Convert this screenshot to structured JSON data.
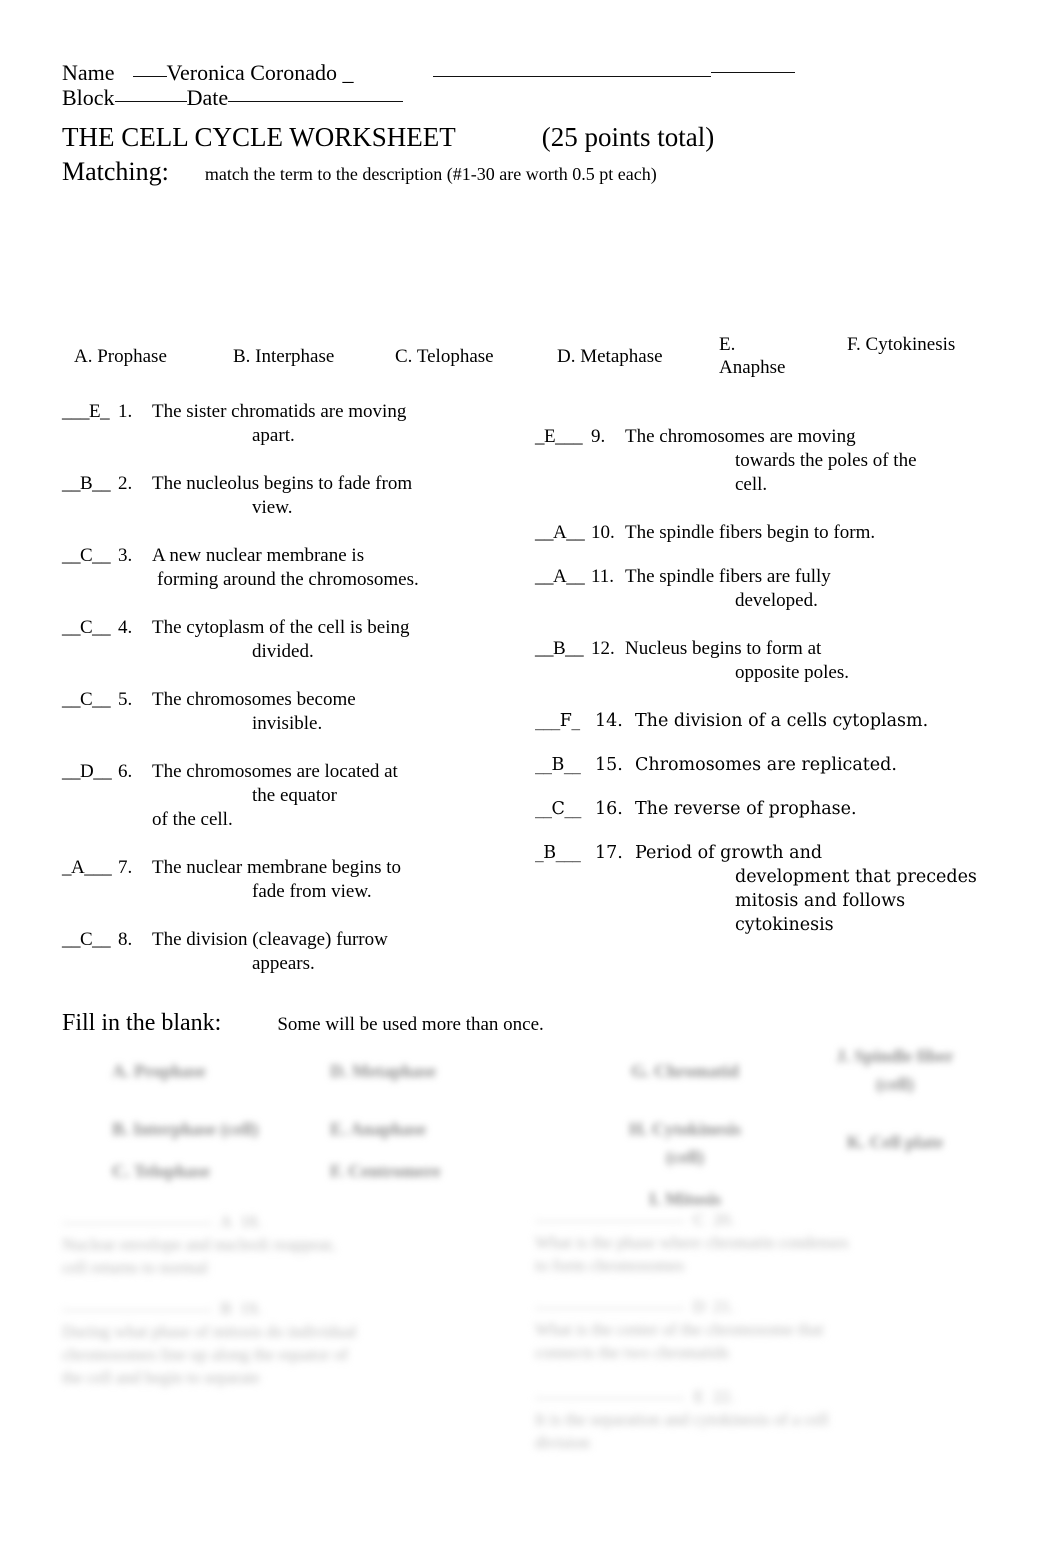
{
  "header": {
    "name_label": "Name",
    "name_value": "Veronica Coronado",
    "name_trailing_underscore": "_",
    "block_label": "Block",
    "date_label": "Date"
  },
  "title": {
    "text": "THE CELL CYCLE WORKSHEET",
    "points": "(25 points total)"
  },
  "matching": {
    "label": "Matching:",
    "note": "match the term to the description (#1-30 are worth 0.5 pt each)",
    "options": [
      "A. Prophase",
      "B. Interphase",
      "C. Telophase",
      "D. Metaphase",
      "E. Anaphse",
      "F. Cytokinesis"
    ],
    "left_items": [
      {
        "answer": "___E_",
        "number": "1.",
        "line1": "The sister chromatids are moving",
        "line2": "apart.",
        "line3": ""
      },
      {
        "answer": "__B__",
        "number": "2.",
        "line1": "The nucleolus begins to fade from",
        "line2": "view.",
        "line3": ""
      },
      {
        "answer": "__C__",
        "number": "3.",
        "line1": "A new nuclear membrane is",
        "line2": "forming around the chromosomes.",
        "line3": ""
      },
      {
        "answer": "__C__",
        "number": "4.",
        "line1": "The cytoplasm of the cell is being",
        "line2": "divided.",
        "line3": ""
      },
      {
        "answer": "__C__",
        "number": "5.",
        "line1": "The chromosomes become",
        "line2": "invisible.",
        "line3": ""
      },
      {
        "answer": "__D__",
        "number": "6.",
        "line1": "The chromosomes are located at",
        "line2": "the equator",
        "line3": "of the cell."
      },
      {
        "answer": "_A___",
        "number": "7.",
        "line1": "The nuclear membrane begins to",
        "line2": "fade from view.",
        "line3": ""
      },
      {
        "answer": "__C__",
        "number": "8.",
        "line1": "The division (cleavage) furrow",
        "line2": "appears.",
        "line3": ""
      }
    ],
    "right_items": [
      {
        "answer": "_E___",
        "number": "9.",
        "line1": "The chromosomes are moving",
        "line2": "towards the poles of the",
        "line3": "cell."
      },
      {
        "answer": "__A__",
        "number": "10.",
        "line1": "The spindle fibers begin to form.",
        "line2": "",
        "line3": ""
      },
      {
        "answer": "__A__",
        "number": "11.",
        "line1": "The spindle fibers are fully",
        "line2": "developed.",
        "line3": ""
      },
      {
        "answer": "__B__",
        "number": "12.",
        "line1": "Nucleus begins to form at",
        "line2": "opposite poles.",
        "line3": ""
      },
      {
        "answer": "___F_",
        "number": "14.",
        "line1": "The division of a cells cytoplasm.",
        "line2": "",
        "line3": ""
      },
      {
        "answer": "__B__",
        "number": "15.",
        "line1": "Chromosomes are replicated.",
        "line2": "",
        "line3": ""
      },
      {
        "answer": "__C__",
        "number": "16.",
        "line1": "The reverse of prophase.",
        "line2": "",
        "line3": ""
      },
      {
        "answer": "_B___",
        "number": "17.",
        "line1": "Period of growth and",
        "line2": "development that precedes",
        "line3": "mitosis and follows",
        "line4": "cytokinesis"
      }
    ]
  },
  "fill_in_blank": {
    "label": "Fill in the blank:",
    "note": "Some will be used more than once.",
    "word_bank": {
      "col1": [
        "A. Prophase",
        "B. Interphase (cell)",
        "C. Telophase"
      ],
      "col2": [
        "D. Metaphase",
        "E. Anaphase",
        "F. Centromere"
      ],
      "col3": [
        "G. Chromatid",
        "H. Cytokinesis",
        "(cell)",
        "I. Mitosis"
      ],
      "col4": [
        "J. Spindle fiber",
        "(cell)",
        "K. Cell plate"
      ]
    },
    "items": [
      {
        "answer": "A",
        "number": "18.",
        "text": "Nuclear envelope and nucleoli reappear, cell returns to normal"
      },
      {
        "answer": "B",
        "number": "19.",
        "text": "During what phase of mitosis do individual chromosomes line up along the equator of the cell and begin to separate"
      },
      {
        "answer": "C",
        "number": "20.",
        "text": "What is the phase where chromatin condenses to form chromosomes"
      },
      {
        "answer": "D",
        "number": "21.",
        "text": "What is the center of the chromosome that connects the two chromatids"
      },
      {
        "answer": "E",
        "number": "22.",
        "text": "It is the separation and cytokinesis of a cell division"
      }
    ]
  }
}
